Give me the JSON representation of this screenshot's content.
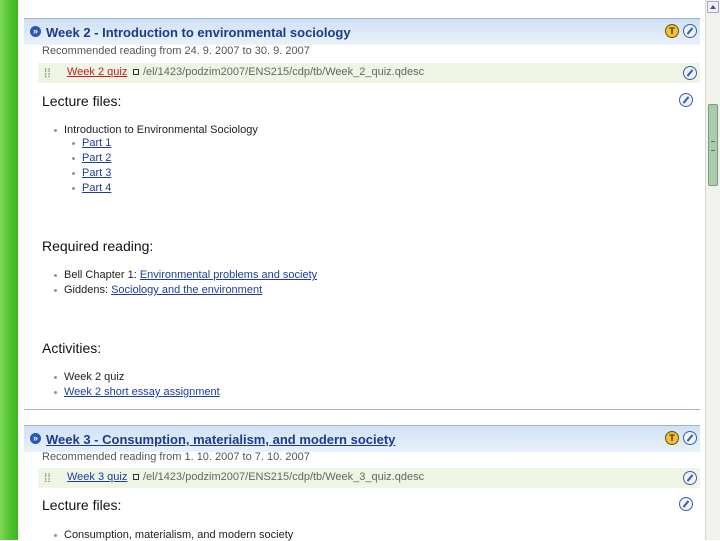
{
  "week2": {
    "title": "Week 2 - Introduction to environmental sociology",
    "recommended": "Recommended reading from 24. 9. 2007 to 30. 9. 2007",
    "quiz_link": "Week 2 quiz",
    "quiz_path": "/el/1423/podzim2007/ENS215/cdp/tb/Week_2_quiz.qdesc",
    "lecture_title": "Lecture files:",
    "lecture_topic": "Introduction to Environmental Sociology",
    "parts": [
      "Part 1",
      "Part 2",
      "Part 3",
      "Part 4"
    ],
    "required_title": "Required reading:",
    "reading1_prefix": "Bell Chapter 1:",
    "reading1_link": "Environmental problems and society",
    "reading2_prefix": "Giddens:",
    "reading2_link": "Sociology and the environment",
    "activities_title": "Activities:",
    "activity1": "Week 2 quiz",
    "activity2": "Week 2 short essay assignment"
  },
  "week3": {
    "title": "Week 3 - Consumption, materialism, and modern society",
    "recommended": "Recommended reading from 1. 10. 2007 to 7. 10. 2007",
    "quiz_link": "Week 3 quiz",
    "quiz_path": "/el/1423/podzim2007/ENS215/cdp/tb/Week_3_quiz.qdesc",
    "lecture_title": "Lecture files:",
    "lecture_topic": "Consumption, materialism, and modern society"
  },
  "icons": {
    "collapse": "collapse-icon",
    "status": "teacher-icon",
    "edit": "edit-icon",
    "quiz": "quiz-icon",
    "popup": "popup-window-icon"
  },
  "colors": {
    "sidebar_green": "#49c22c",
    "header_blue": "#cfe0f4",
    "title_blue": "#1b3c8c",
    "quiz_red": "#c4201a",
    "link_blue": "#1d3e9e"
  }
}
